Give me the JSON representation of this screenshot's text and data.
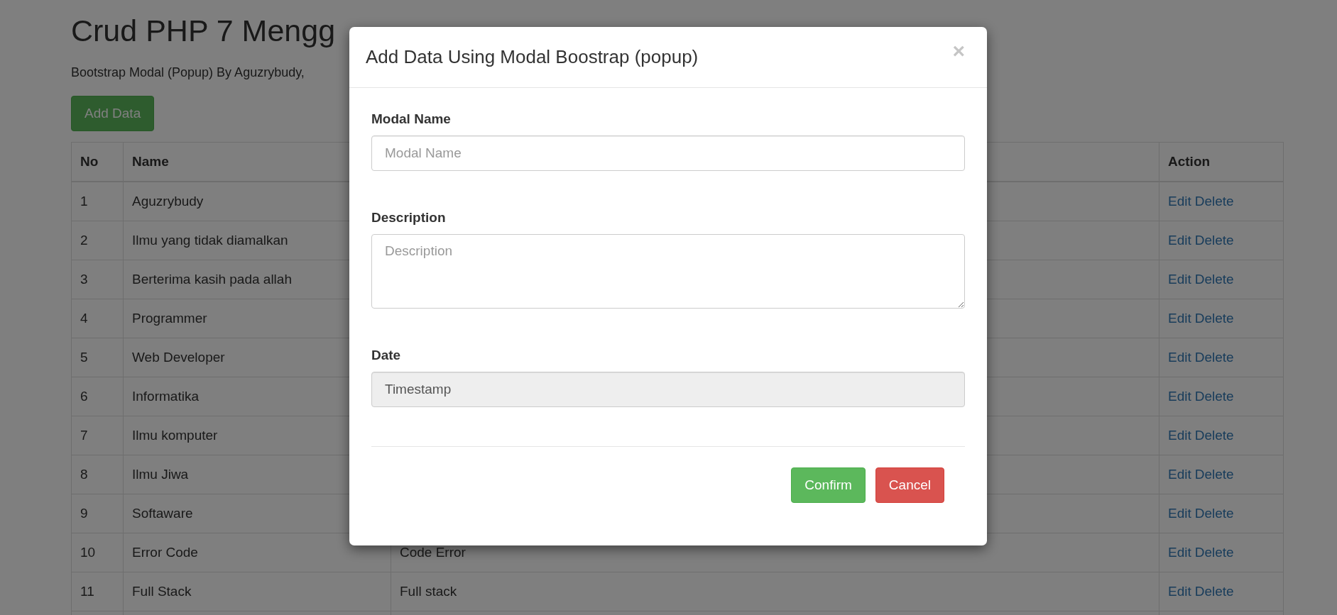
{
  "page": {
    "title": "Crud PHP 7 Mengg",
    "subtitle": "Bootstrap Modal (Popup) By Aguzrybudy,",
    "add_button": "Add Data"
  },
  "table": {
    "columns": [
      "No",
      "Name",
      "",
      "Action"
    ],
    "rows": [
      {
        "no": "1",
        "name": "Aguzrybudy",
        "actions": [
          "Edit",
          "Delete"
        ]
      },
      {
        "no": "2",
        "name": "Ilmu yang tidak diamalkan",
        "actions": [
          "Edit",
          "Delete"
        ]
      },
      {
        "no": "3",
        "name": "Berterima kasih pada allah",
        "actions": [
          "Edit",
          "Delete"
        ]
      },
      {
        "no": "4",
        "name": "Programmer",
        "actions": [
          "Edit",
          "Delete"
        ]
      },
      {
        "no": "5",
        "name": "Web Developer",
        "actions": [
          "Edit",
          "Delete"
        ]
      },
      {
        "no": "6",
        "name": "Informatika",
        "actions": [
          "Edit",
          "Delete"
        ]
      },
      {
        "no": "7",
        "name": "Ilmu komputer",
        "actions": [
          "Edit",
          "Delete"
        ]
      },
      {
        "no": "8",
        "name": "Ilmu Jiwa",
        "actions": [
          "Edit",
          "Delete"
        ]
      },
      {
        "no": "9",
        "name": "Softaware",
        "actions": [
          "Edit",
          "Delete"
        ]
      },
      {
        "no": "10",
        "name": "Error Code",
        "description": "Code Error",
        "actions": [
          "Edit",
          "Delete"
        ]
      },
      {
        "no": "11",
        "name": "Full Stack",
        "description": "Full stack",
        "actions": [
          "Edit",
          "Delete"
        ]
      }
    ]
  },
  "modal": {
    "title": "Add Data Using Modal Boostrap (popup)",
    "close": "×",
    "fields": [
      {
        "kind": "input",
        "label": "Modal Name",
        "placeholder": "Modal Name",
        "readonly": false
      },
      {
        "kind": "textarea",
        "label": "Description",
        "placeholder": "Description",
        "readonly": false
      },
      {
        "kind": "input",
        "label": "Date",
        "value": "Timestamp",
        "readonly": true
      }
    ],
    "buttons": [
      {
        "label": "Confirm",
        "kind": "success"
      },
      {
        "label": "Cancel",
        "kind": "danger"
      }
    ]
  }
}
